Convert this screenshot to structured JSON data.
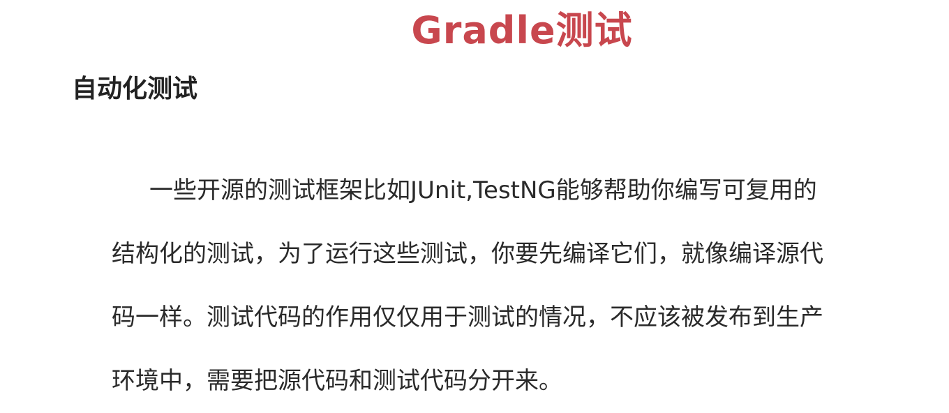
{
  "slide": {
    "title": "Gradle测试",
    "section_heading": "自动化测试",
    "paragraph_lines": [
      "一些开源的测试框架比如JUnit,TestNG能够帮助你编写可复用的",
      "结构化的测试，为了运行这些测试，你要先编译它们，就像编译源代",
      "码一样。测试代码的作用仅仅用于测试的情况，不应该被发布到生产",
      "环境中，需要把源代码和测试代码分开来。"
    ]
  },
  "colors": {
    "title": "#c8474e",
    "heading": "#222222",
    "body": "#2a2a2a",
    "background": "#ffffff"
  }
}
